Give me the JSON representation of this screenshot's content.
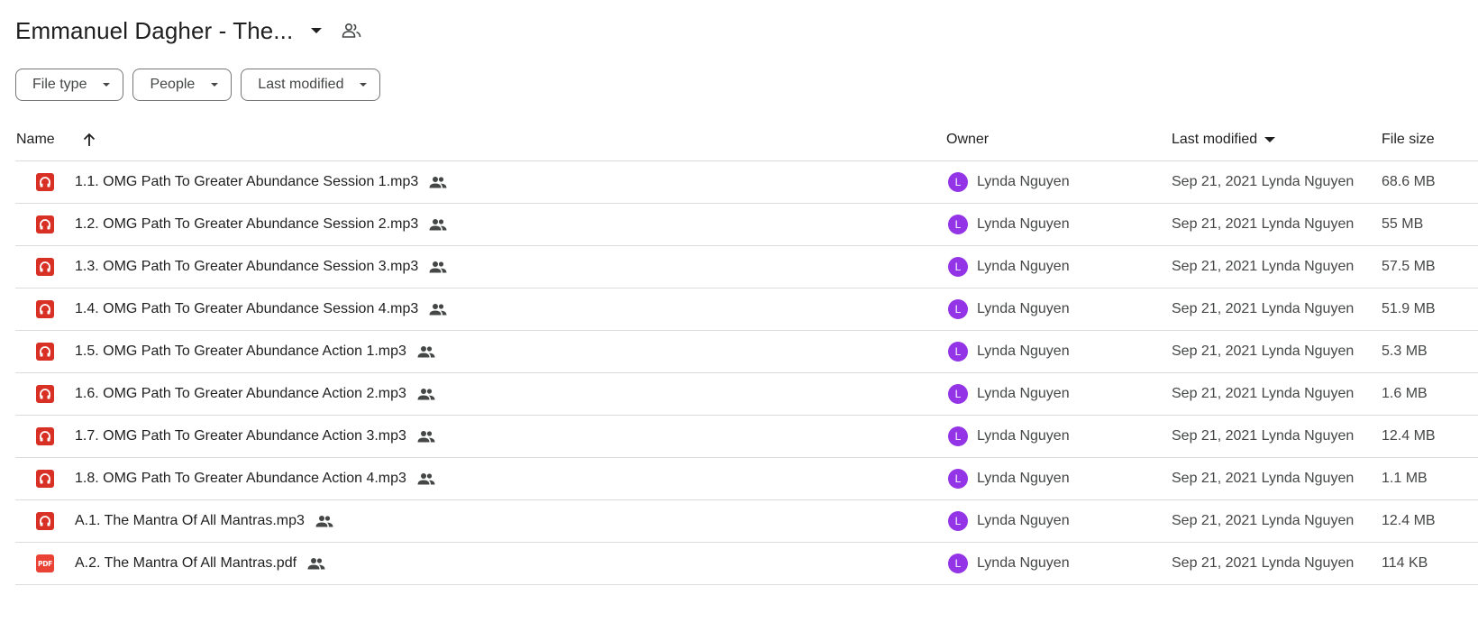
{
  "header": {
    "folder_title": "Emmanuel Dagher - The...",
    "dropdown_icon": "arrow-drop-down-icon",
    "shared_icon": "people-outline-icon"
  },
  "filters": [
    {
      "label": "File type"
    },
    {
      "label": "People"
    },
    {
      "label": "Last modified"
    }
  ],
  "table": {
    "columns": {
      "name": "Name",
      "owner": "Owner",
      "last_modified": "Last modified",
      "file_size": "File size"
    },
    "sort_icon": "arrow-upward-icon",
    "rows": [
      {
        "type": "audio",
        "name": "1.1. OMG Path To Greater Abundance Session 1.mp3",
        "owner_initial": "L",
        "owner": "Lynda Nguyen",
        "modified": "Sep 21, 2021 Lynda Nguyen",
        "size": "68.6 MB"
      },
      {
        "type": "audio",
        "name": "1.2. OMG Path To Greater Abundance Session 2.mp3",
        "owner_initial": "L",
        "owner": "Lynda Nguyen",
        "modified": "Sep 21, 2021 Lynda Nguyen",
        "size": "55 MB"
      },
      {
        "type": "audio",
        "name": "1.3. OMG Path To Greater Abundance Session 3.mp3",
        "owner_initial": "L",
        "owner": "Lynda Nguyen",
        "modified": "Sep 21, 2021 Lynda Nguyen",
        "size": "57.5 MB"
      },
      {
        "type": "audio",
        "name": "1.4. OMG Path To Greater Abundance Session 4.mp3",
        "owner_initial": "L",
        "owner": "Lynda Nguyen",
        "modified": "Sep 21, 2021 Lynda Nguyen",
        "size": "51.9 MB"
      },
      {
        "type": "audio",
        "name": "1.5. OMG Path To Greater Abundance Action 1.mp3",
        "owner_initial": "L",
        "owner": "Lynda Nguyen",
        "modified": "Sep 21, 2021 Lynda Nguyen",
        "size": "5.3 MB"
      },
      {
        "type": "audio",
        "name": "1.6. OMG Path To Greater Abundance Action 2.mp3",
        "owner_initial": "L",
        "owner": "Lynda Nguyen",
        "modified": "Sep 21, 2021 Lynda Nguyen",
        "size": "1.6 MB"
      },
      {
        "type": "audio",
        "name": "1.7. OMG Path To Greater Abundance Action 3.mp3",
        "owner_initial": "L",
        "owner": "Lynda Nguyen",
        "modified": "Sep 21, 2021 Lynda Nguyen",
        "size": "12.4 MB"
      },
      {
        "type": "audio",
        "name": "1.8. OMG Path To Greater Abundance Action 4.mp3",
        "owner_initial": "L",
        "owner": "Lynda Nguyen",
        "modified": "Sep 21, 2021 Lynda Nguyen",
        "size": "1.1 MB"
      },
      {
        "type": "audio",
        "name": "A.1. The Mantra Of All Mantras.mp3",
        "owner_initial": "L",
        "owner": "Lynda Nguyen",
        "modified": "Sep 21, 2021 Lynda Nguyen",
        "size": "12.4 MB"
      },
      {
        "type": "pdf",
        "name": "A.2. The Mantra Of All Mantras.pdf",
        "owner_initial": "L",
        "owner": "Lynda Nguyen",
        "modified": "Sep 21, 2021 Lynda Nguyen",
        "size": "114 KB"
      }
    ]
  },
  "icons": {
    "audio": "headphones-file-icon",
    "pdf": "pdf-file-icon",
    "shared": "shared-people-icon"
  },
  "pdf_badge_text": "PDF",
  "colors": {
    "audio_icon": "#d93025",
    "pdf_icon": "#ea4335",
    "avatar": "#9334e6",
    "divider": "#dadce0"
  }
}
